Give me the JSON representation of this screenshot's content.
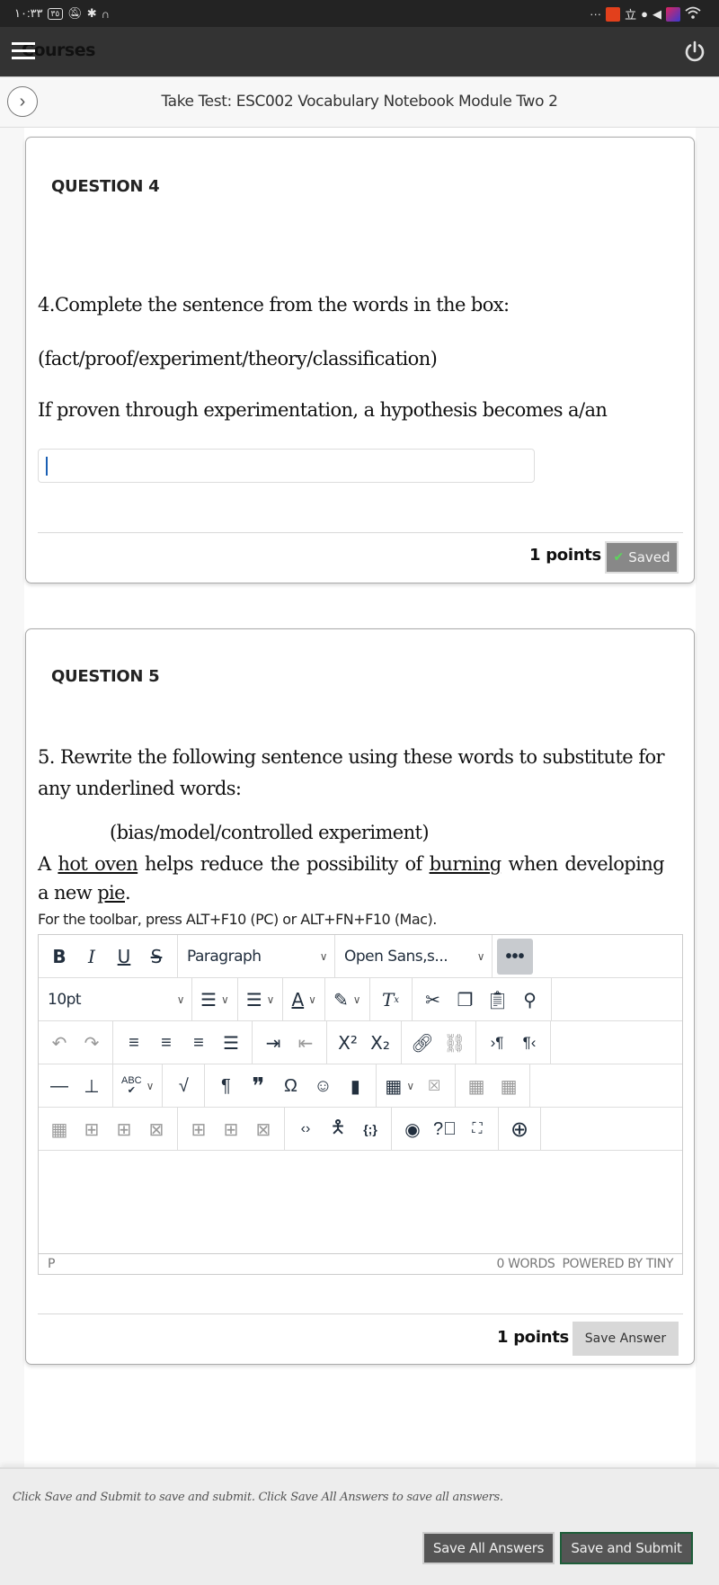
{
  "status_bar": {
    "time": "١٠:٣٣",
    "battery": "٣٥",
    "left_icons": [
      "notifications-off-icon",
      "bluetooth-icon",
      "headphones-icon"
    ],
    "right_icons": [
      "more-icon",
      "app-icon",
      "translate-icon",
      "facebook-icon",
      "telegram-icon",
      "puzzle-app-icon",
      "wifi-icon"
    ],
    "overflow": "···",
    "wifi_label": "6"
  },
  "header": {
    "menu_icon": "hamburger-icon",
    "title": "Courses",
    "power_icon": "power-icon"
  },
  "title_bar": {
    "nav_icon": "chevron-right-icon",
    "title": "Take Test: ESC002 Vocabulary Notebook Module Two 2"
  },
  "questions": [
    {
      "label": "QUESTION 4",
      "prompt_line1": "4.Complete the sentence from the words in the box:",
      "word_bank": "(fact/proof/experiment/theory/classification)",
      "sentence": "If proven through experimentation, a hypothesis becomes a/an",
      "answer_value": "",
      "points": "1 points",
      "status_button": "Saved"
    },
    {
      "label": "QUESTION 5",
      "prompt": "5. Rewrite the following sentence using these words to substitute for any underlined words:",
      "word_bank": "(bias/model/controlled experiment)",
      "sentence_parts": {
        "p1": "A ",
        "u1": "hot oven",
        "p2": " helps reduce the possibility of ",
        "u2": "burning",
        "p3": " when developing a new ",
        "u3": "pie",
        "p4": "."
      },
      "toolbar_hint": "For the toolbar, press ALT+F10 (PC) or ALT+FN+F10 (Mac).",
      "editor": {
        "block_format": "Paragraph",
        "font_family": "Open Sans,s...",
        "font_size": "10pt",
        "status_path": "P",
        "word_count": "0 WORDS",
        "powered_by": "POWERED BY TINY",
        "content": ""
      },
      "points": "1 points",
      "save_button": "Save Answer"
    }
  ],
  "footer": {
    "note": "Click Save and Submit to save and submit. Click Save All Answers to save all answers.",
    "save_all": "Save All Answers",
    "save_submit": "Save and Submit"
  }
}
